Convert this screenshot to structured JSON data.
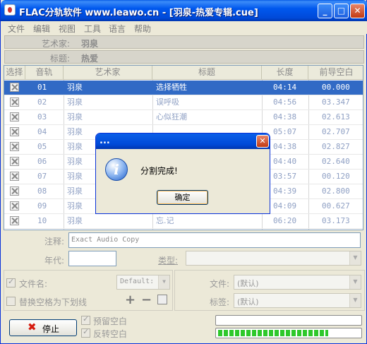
{
  "window": {
    "title": "FLAC分轨软件 www.leawo.cn - [羽泉-热爱专辑.cue]"
  },
  "titlebar_buttons": {
    "minimize": "_",
    "maximize": "□",
    "close": "✕"
  },
  "menu": [
    "文件",
    "编辑",
    "视图",
    "工具",
    "语言",
    "帮助"
  ],
  "album": {
    "artist_label": "艺术家:",
    "artist_value": "羽泉",
    "title_label": "标题:",
    "title_value": "热爱"
  },
  "table": {
    "headers": [
      "选择",
      "音轨",
      "艺术家",
      "标题",
      "长度",
      "前导空白"
    ],
    "rows": [
      {
        "track": "01",
        "artist": "羽泉",
        "title": "选择牺牲",
        "length": "04:14",
        "pregap": "00.000",
        "selected": true
      },
      {
        "track": "02",
        "artist": "羽泉",
        "title": "误呼吸",
        "length": "04:56",
        "pregap": "03.347",
        "selected": false
      },
      {
        "track": "03",
        "artist": "羽泉",
        "title": "心似狂潮",
        "length": "04:38",
        "pregap": "02.613",
        "selected": false
      },
      {
        "track": "04",
        "artist": "羽泉",
        "title": "",
        "length": "05:07",
        "pregap": "02.707",
        "selected": false
      },
      {
        "track": "05",
        "artist": "羽泉",
        "title": "",
        "length": "04:38",
        "pregap": "02.827",
        "selected": false
      },
      {
        "track": "06",
        "artist": "羽泉",
        "title": "",
        "length": "04:40",
        "pregap": "02.640",
        "selected": false
      },
      {
        "track": "07",
        "artist": "羽泉",
        "title": "",
        "length": "03:57",
        "pregap": "00.120",
        "selected": false
      },
      {
        "track": "08",
        "artist": "羽泉",
        "title": "",
        "length": "04:39",
        "pregap": "02.800",
        "selected": false
      },
      {
        "track": "09",
        "artist": "羽泉",
        "title": "",
        "length": "04:09",
        "pregap": "00.627",
        "selected": false
      },
      {
        "track": "10",
        "artist": "羽泉",
        "title": "忘.记",
        "length": "06:20",
        "pregap": "03.173",
        "selected": false
      }
    ]
  },
  "metadata": {
    "comment_label": "注释:",
    "comment_value": "Exact Audio Copy",
    "year_label": "年代:",
    "year_value": "",
    "genre_label": "类型:",
    "genre_value": ""
  },
  "options": {
    "filename_label": "文件名:",
    "filename_value": "Default:",
    "replace_space_label": "替换空格为下划线",
    "file_label": "文件:",
    "file_value": "(默认)",
    "tag_label": "标签:",
    "tag_value": "(默认)",
    "keep_gap_label": "预留空白",
    "reverse_gap_label": "反转空白",
    "add_icon": "+",
    "remove_icon": "−"
  },
  "actions": {
    "stop_label": "停止",
    "stop_icon": "✖"
  },
  "progress": {
    "bar1": 0.0,
    "bar2": 0.78
  },
  "dialog": {
    "title": "...",
    "message": "分割完成!",
    "ok_label": "确定",
    "icon": "i",
    "close": "✕"
  }
}
